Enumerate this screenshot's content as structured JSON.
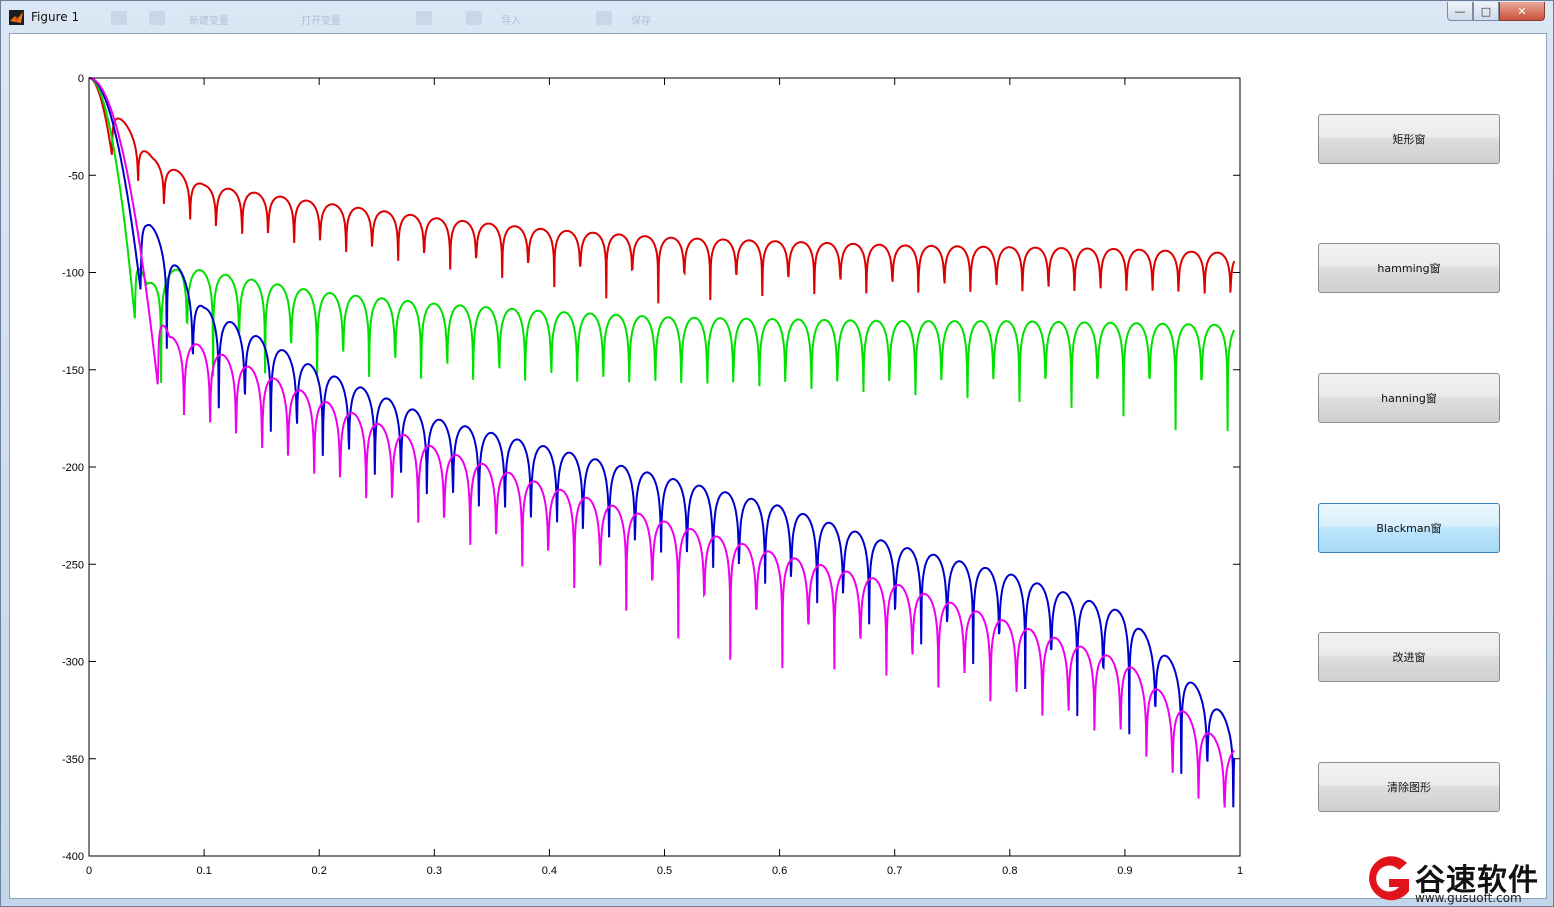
{
  "window": {
    "title": "Figure 1",
    "ghost_toolbar": [
      "新建变量",
      "打开变量",
      "导入",
      "保存"
    ]
  },
  "buttons": [
    {
      "label": "矩形窗",
      "active": false
    },
    {
      "label": "hamming窗",
      "active": false
    },
    {
      "label": "hanning窗",
      "active": false
    },
    {
      "label": "Blackman窗",
      "active": true
    },
    {
      "label": "改进窗",
      "active": false
    },
    {
      "label": "清除图形",
      "active": false
    }
  ],
  "watermark": {
    "text": "谷速软件",
    "url": "www.gusuoft.com"
  },
  "chart_data": {
    "type": "line",
    "title": "",
    "xlabel": "",
    "ylabel": "",
    "xlim": [
      0,
      1
    ],
    "ylim": [
      -400,
      0
    ],
    "xticks": [
      "0",
      "0.1",
      "0.2",
      "0.3",
      "0.4",
      "0.5",
      "0.6",
      "0.7",
      "0.8",
      "0.9",
      "1"
    ],
    "yticks": [
      "0",
      "-50",
      "-100",
      "-150",
      "-200",
      "-250",
      "-300",
      "-350",
      "-400"
    ],
    "grid": false,
    "legend": "none",
    "series": [
      {
        "color": "#dd0000",
        "peaks_x": [
          0.0,
          0.055,
          0.1,
          0.2,
          0.3,
          0.4,
          0.5,
          0.6,
          0.7,
          0.8,
          0.9,
          0.99
        ],
        "peaks_y": [
          0,
          -41,
          -55,
          -64,
          -72,
          -78,
          -82,
          -84,
          -86,
          -87,
          -88,
          -90
        ],
        "null_depth_db": 25,
        "first_null_x": 0.02,
        "lobe_width": 0.0226
      },
      {
        "color": "#00e000",
        "peaks_x": [
          0.0,
          0.05,
          0.08,
          0.2,
          0.3,
          0.4,
          0.5,
          0.6,
          0.7,
          0.8,
          0.9,
          0.99
        ],
        "peaks_y": [
          0,
          -106,
          -97,
          -110,
          -116,
          -120,
          -123,
          -124,
          -125,
          -125,
          -126,
          -127
        ],
        "null_depth_db": 40,
        "first_null_x": 0.04,
        "lobe_width": 0.0226
      },
      {
        "color": "#0000cc",
        "peaks_x": [
          0.0,
          0.05,
          0.1,
          0.2,
          0.3,
          0.4,
          0.5,
          0.6,
          0.7,
          0.8,
          0.9,
          0.99
        ],
        "peaks_y": [
          0,
          -72,
          -118,
          -150,
          -175,
          -190,
          -205,
          -220,
          -240,
          -255,
          -275,
          -330
        ],
        "null_depth_db": 45,
        "first_null_x": 0.045,
        "lobe_width": 0.0226
      },
      {
        "color": "#ee00ee",
        "peaks_x": [
          0.0,
          0.07,
          0.1,
          0.2,
          0.3,
          0.4,
          0.5,
          0.6,
          0.7,
          0.8,
          0.9,
          0.99
        ],
        "peaks_y": [
          0,
          -133,
          -138,
          -165,
          -190,
          -210,
          -228,
          -245,
          -260,
          -280,
          -300,
          -345
        ],
        "null_depth_db": 45,
        "first_null_x": 0.06,
        "lobe_width": 0.0226
      }
    ]
  }
}
